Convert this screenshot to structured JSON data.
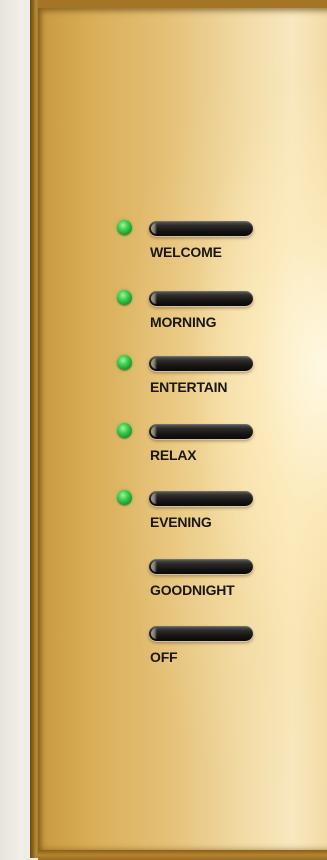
{
  "keypad": {
    "buttons": [
      {
        "label": "WELCOME",
        "led_on": true
      },
      {
        "label": "MORNING",
        "led_on": true
      },
      {
        "label": "ENTERTAIN",
        "led_on": true
      },
      {
        "label": "RELAX",
        "led_on": true
      },
      {
        "label": "EVENING",
        "led_on": true
      },
      {
        "label": "GOODNIGHT",
        "led_on": false
      },
      {
        "label": "OFF",
        "led_on": false
      }
    ]
  },
  "colors": {
    "led_active": "#3fcf4f",
    "plate_brass": "#e5c27a",
    "button_dark": "#141312",
    "label_text": "#1a1611"
  }
}
